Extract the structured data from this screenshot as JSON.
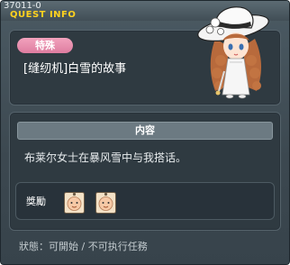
{
  "window": {
    "quest_id": "37011-0",
    "title": "QUEST INFO"
  },
  "quest": {
    "category_tag": "特殊",
    "name": "[缝纫机]白雪的故事",
    "character_icon": "girl-in-white-hat-icon"
  },
  "content": {
    "section_title": "内容",
    "description": "布莱尔女士在暴风雪中与我搭话。"
  },
  "rewards": {
    "label": "獎勵",
    "items": [
      {
        "icon": "face-tag-item-icon"
      },
      {
        "icon": "face-tag-item-icon"
      }
    ]
  },
  "footer": {
    "status": "狀態：可開始 / 不可执行任務"
  },
  "colors": {
    "title_accent": "#ffd21e",
    "tag_pink": "#e88aab",
    "panel_bg": "#2f3a41",
    "section_head_bg": "#6c7a82"
  }
}
